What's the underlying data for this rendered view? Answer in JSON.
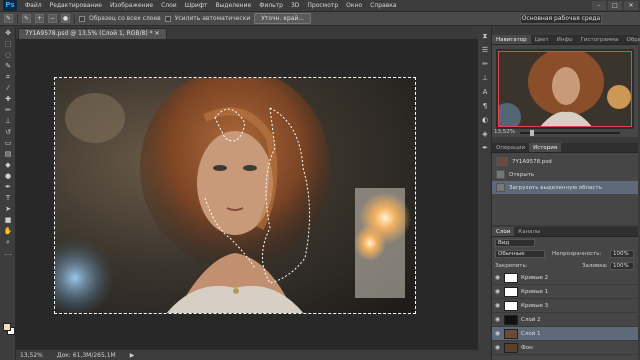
{
  "app": {
    "logo": "Ps",
    "menu": [
      "Файл",
      "Редактирование",
      "Изображение",
      "Слои",
      "Шрифт",
      "Выделение",
      "Фильтр",
      "3D",
      "Просмотр",
      "Окно",
      "Справка"
    ],
    "window_controls": [
      "–",
      "□",
      "✕"
    ]
  },
  "options_bar": {
    "sample_all_label": "Образец со всех слоев",
    "auto_enhance_label": "Усилить автоматически",
    "refine_button": "Уточн. край...",
    "workspace": "Основная рабочая среда"
  },
  "document": {
    "tab_title": "7Y1A9578.psd @ 13,5% (Слой 1, RGB/8) *",
    "zoom": "13,52%",
    "doc_info": "Док: 61,3M/265,1M"
  },
  "navigator": {
    "tabs": [
      "Навигатор",
      "Цвет",
      "Инфо",
      "Гистограмма",
      "Образцы"
    ],
    "active_tab": 0,
    "zoom": "13,52%",
    "zoom_slider_level": 0.1
  },
  "history": {
    "tabs": [
      "Операции",
      "История"
    ],
    "active_tab": 1,
    "snapshot": "7Y1A9578.psd",
    "items": [
      "Открыть",
      "Загрузить выделенную область"
    ],
    "selected_index": 1
  },
  "layers": {
    "tabs": [
      "Слои",
      "Каналы"
    ],
    "active_tab": 0,
    "kind_filter": "Вид",
    "blend_mode": "Обычные",
    "opacity_label": "Непрозрачность:",
    "opacity_value": "100%",
    "lock_label": "Закрепить:",
    "fill_label": "Заливка:",
    "fill_value": "100%",
    "items": [
      {
        "name": "Кривые 2",
        "type": "adjustment",
        "thumb": "#ffffff",
        "selected": false
      },
      {
        "name": "Кривые 1",
        "type": "adjustment",
        "thumb": "#ffffff",
        "selected": false
      },
      {
        "name": "Кривые 3",
        "type": "adjustment",
        "thumb": "#ffffff",
        "selected": false
      },
      {
        "name": "Слой 2",
        "type": "pixel",
        "thumb": "#111111",
        "selected": false
      },
      {
        "name": "Слой 1",
        "type": "pixel",
        "thumb": "#6a4a38",
        "selected": true
      },
      {
        "name": "Фон",
        "type": "pixel",
        "thumb": "#5a4030",
        "selected": false
      }
    ]
  },
  "colors": {
    "foreground": "#f0e0c0",
    "background": "#ffffff",
    "selection_accent": "#5e6a7a",
    "navigator_frame": "#e84545"
  }
}
